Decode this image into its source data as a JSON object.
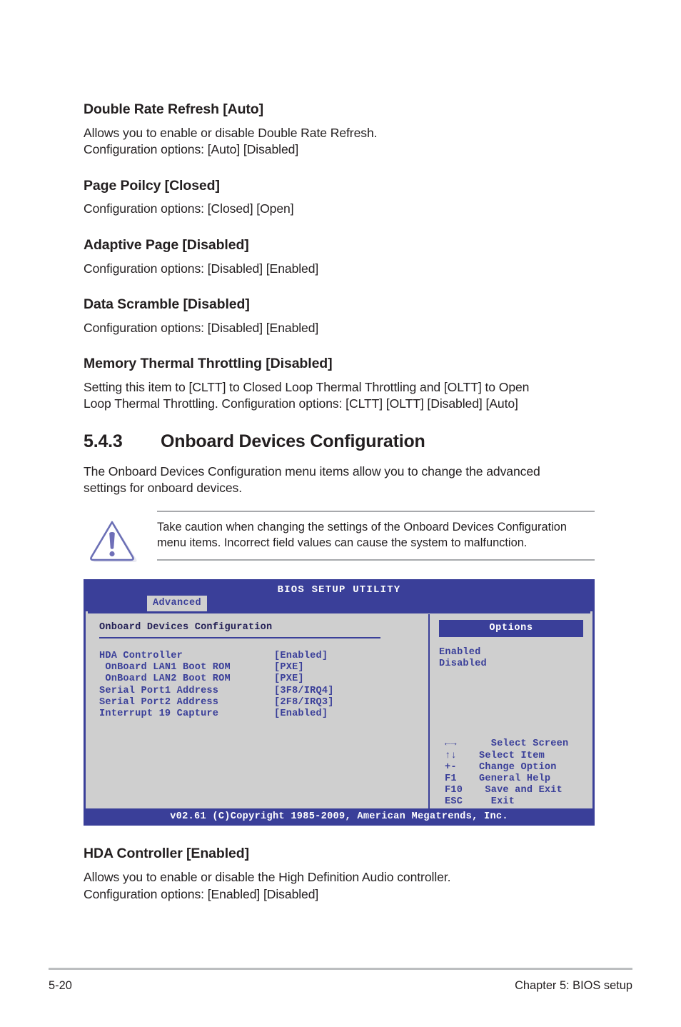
{
  "document": {
    "items": [
      {
        "heading": "Double Rate Refresh [Auto]",
        "lines": [
          "Allows you to enable or disable Double Rate Refresh.",
          "Configuration options: [Auto] [Disabled]"
        ]
      },
      {
        "heading": "Page Poilcy [Closed]",
        "lines": [
          "Configuration options: [Closed] [Open]"
        ]
      },
      {
        "heading": "Adaptive Page [Disabled]",
        "lines": [
          "Configuration options: [Disabled] [Enabled]"
        ]
      },
      {
        "heading": "Data Scramble [Disabled]",
        "lines": [
          "Configuration options: [Disabled] [Enabled]"
        ]
      },
      {
        "heading": "Memory Thermal Throttling [Disabled]",
        "lines": [
          "Setting this item to [CLTT] to Closed Loop Thermal Throttling and [OLTT] to Open",
          "Loop Thermal Throttling. Configuration options: [CLTT] [OLTT] [Disabled] [Auto]"
        ]
      }
    ],
    "section": {
      "number": "5.4.3",
      "title": "Onboard Devices Configuration",
      "intro_lines": [
        "The Onboard Devices Configuration menu items allow you to change the advanced",
        "settings for onboard devices."
      ]
    },
    "caution": {
      "icon": "warning-triangle-icon",
      "lines": [
        "Take caution when changing the settings of the Onboard Devices Configuration",
        "menu items. Incorrect field values can cause the system to malfunction."
      ]
    },
    "trailing_item": {
      "heading": "HDA Controller [Enabled]",
      "lines": [
        "Allows you to enable or disable the High Definition Audio controller.",
        "Configuration options: [Enabled] [Disabled]"
      ]
    },
    "footer": {
      "page_number": "5-20",
      "chapter": "Chapter 5: BIOS setup"
    }
  },
  "bios": {
    "title": "BIOS SETUP UTILITY",
    "active_tab": "Advanced",
    "panel_title": "Onboard Devices Configuration",
    "settings": [
      {
        "label": "HDA Controller",
        "value": "[Enabled]"
      },
      {
        "label": " OnBoard LAN1 Boot ROM",
        "value": "[PXE]"
      },
      {
        "label": " OnBoard LAN2 Boot ROM",
        "value": "[PXE]"
      },
      {
        "label": "Serial Port1 Address",
        "value": "[3F8/IRQ4]"
      },
      {
        "label": "Serial Port2 Address",
        "value": "[2F8/IRQ3]"
      },
      {
        "label": "Interrupt 19 Capture",
        "value": "[Enabled]"
      }
    ],
    "options_header": "Options",
    "options": [
      "Enabled",
      "Disabled"
    ],
    "keys": [
      {
        "key": "←→",
        "action": "  Select Screen"
      },
      {
        "key": "↑↓",
        "action": "Select Item"
      },
      {
        "key": "+-",
        "action": "Change Option"
      },
      {
        "key": "F1",
        "action": "General Help"
      },
      {
        "key": "F10",
        "action": " Save and Exit"
      },
      {
        "key": "ESC",
        "action": "  Exit"
      }
    ],
    "copyright": "v02.61 (C)Copyright 1985-2009, American Megatrends, Inc.",
    "colors": {
      "header_blue": "#3a3f99",
      "body_grey": "#cfcfcf",
      "text_blue": "#3a3f99"
    }
  }
}
